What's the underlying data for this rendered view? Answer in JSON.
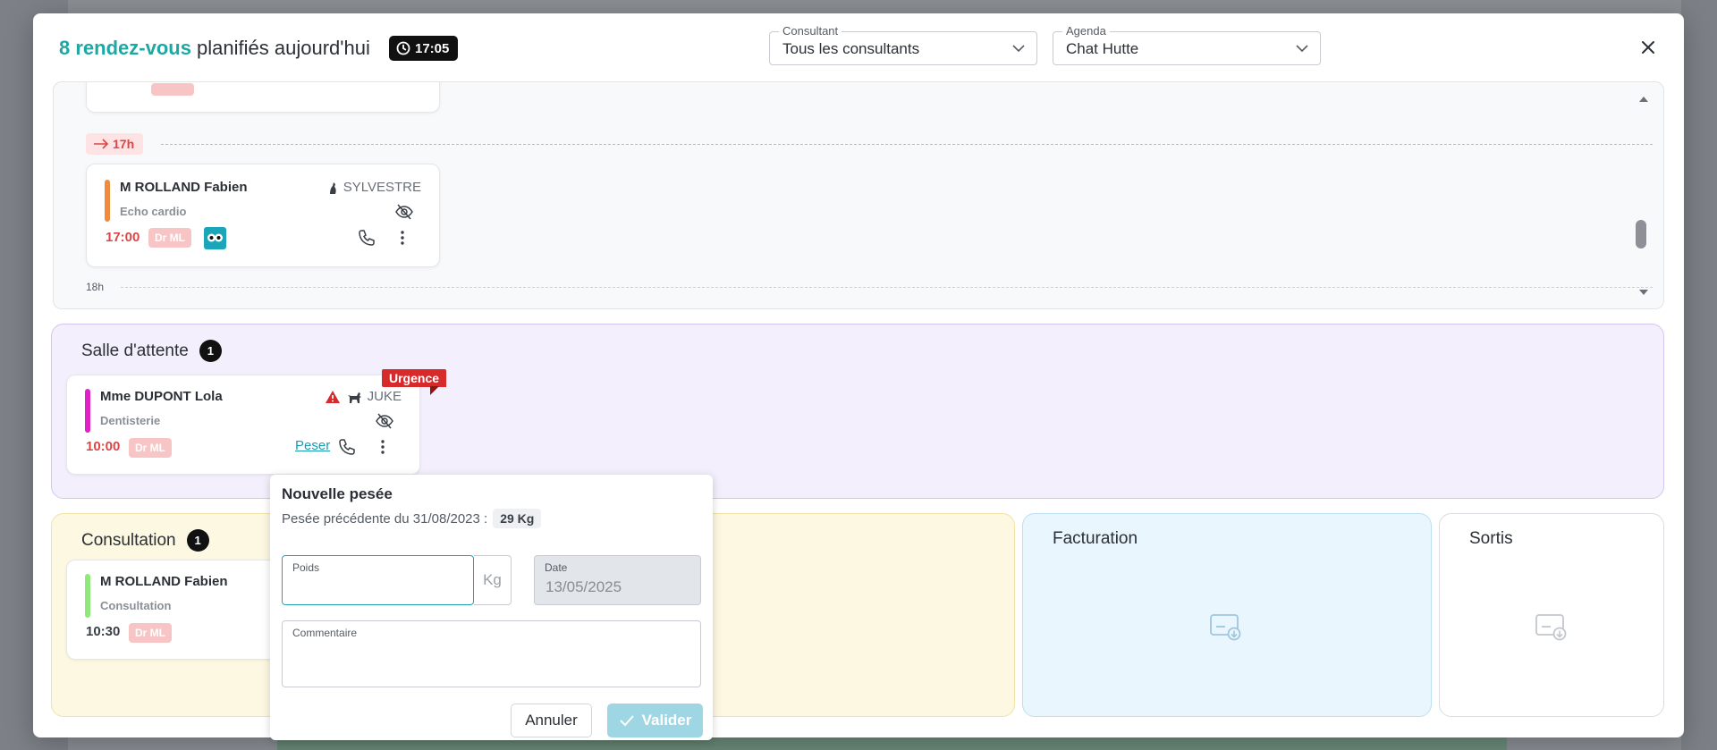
{
  "header": {
    "count_text": "8 rendez-vous",
    "title_rest": " planifiés aujourd'hui",
    "clock": "17:05",
    "consultant": {
      "label": "Consultant",
      "value": "Tous les consultants"
    },
    "agenda": {
      "label": "Agenda",
      "value": "Chat Hutte"
    }
  },
  "timeline": {
    "hour_marker": "17h",
    "next_hour": "18h",
    "appointment": {
      "name": "M ROLLAND Fabien",
      "animal": "SYLVESTRE",
      "type": "Echo cardio",
      "time": "17:00",
      "doctor": "Dr ML"
    }
  },
  "waiting": {
    "title": "Salle d'attente",
    "count": "1",
    "card": {
      "badge": "Urgence",
      "name": "Mme DUPONT Lola",
      "animal": "JUKE",
      "type": "Dentisterie",
      "time": "10:00",
      "doctor": "Dr ML",
      "weigh_link": "Peser"
    }
  },
  "consultation": {
    "title": "Consultation",
    "count": "1",
    "card": {
      "name": "M ROLLAND Fabien",
      "type": "Consultation",
      "time": "10:30",
      "doctor": "Dr ML"
    }
  },
  "billing": {
    "title": "Facturation"
  },
  "exits": {
    "title": "Sortis"
  },
  "weigh_popover": {
    "title": "Nouvelle pesée",
    "previous_label": "Pesée précédente du 31/08/2023 :",
    "previous_value": "29 Kg",
    "weight_label": "Poids",
    "unit": "Kg",
    "date_label": "Date",
    "date_value": "13/05/2025",
    "comment_label": "Commentaire",
    "cancel": "Annuler",
    "confirm": "Valider"
  },
  "colors": {
    "accent": "#1ea7a3",
    "urgent": "#d72b2b",
    "time_red": "#e04545",
    "bar_orange": "#f08a3c",
    "bar_magenta": "#e021c8",
    "bar_green": "#8fe87a"
  }
}
